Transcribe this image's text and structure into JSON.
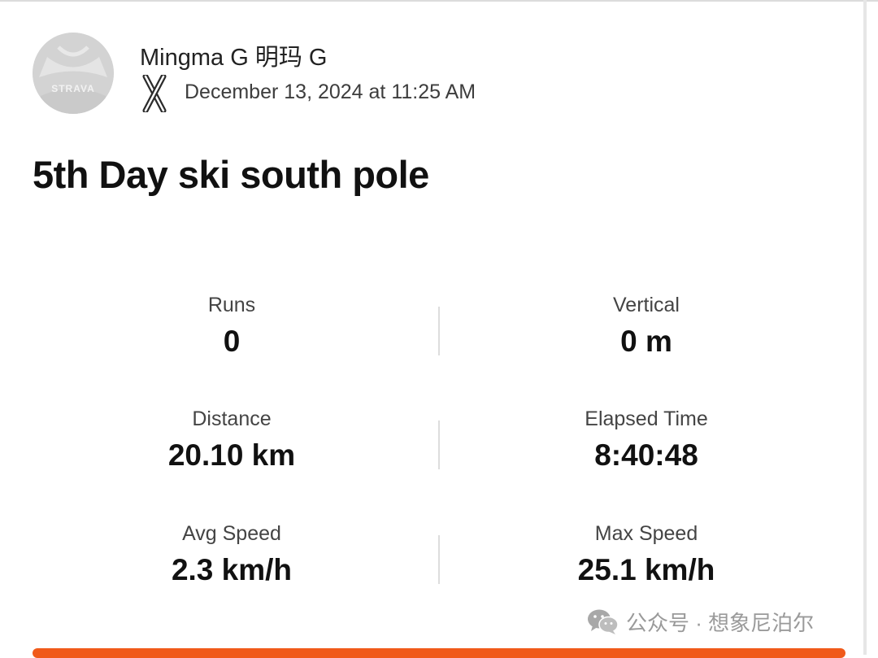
{
  "athlete": {
    "name": "Mingma G 明玛 G",
    "avatar_text": "STRAVA"
  },
  "activity": {
    "sport_icon": "nordic-ski-icon",
    "date": "December 13, 2024 at 11:25 AM",
    "title": "5th Day ski south pole"
  },
  "stats": {
    "runs": {
      "label": "Runs",
      "value": "0"
    },
    "vertical": {
      "label": "Vertical",
      "value": "0 m"
    },
    "distance": {
      "label": "Distance",
      "value": "20.10 km"
    },
    "elapsed_time": {
      "label": "Elapsed Time",
      "value": "8:40:48"
    },
    "avg_speed": {
      "label": "Avg Speed",
      "value": "2.3 km/h"
    },
    "max_speed": {
      "label": "Max Speed",
      "value": "25.1 km/h"
    }
  },
  "watermark": {
    "icon": "wechat-icon",
    "text": "公众号 · 想象尼泊尔"
  },
  "colors": {
    "accent": "#f05a1a",
    "avatar_bg": "#d5d5d5",
    "label_text": "#444444",
    "value_text": "#111111"
  }
}
